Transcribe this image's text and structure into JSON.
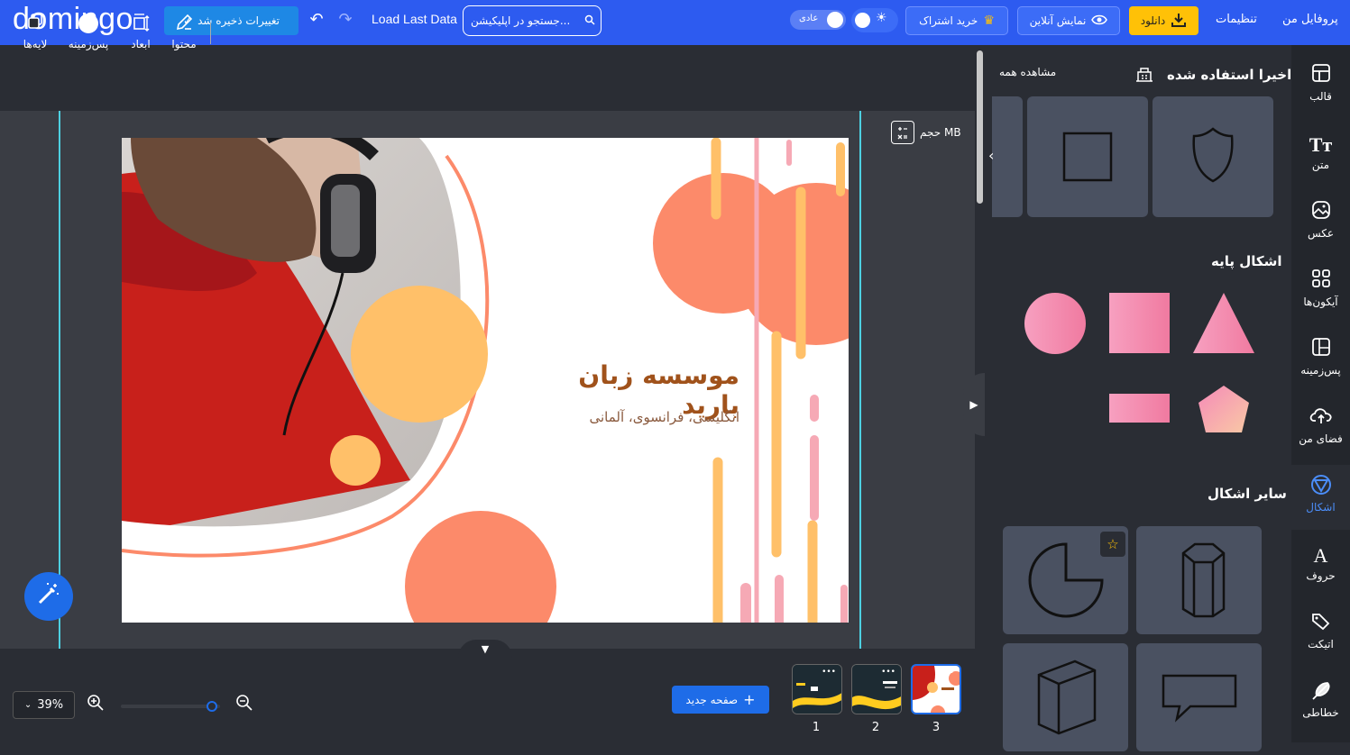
{
  "app": {
    "logo": "domingo"
  },
  "topbar": {
    "saved_label": "تغییرات ذخیره شد",
    "load_last": "Load Last Data",
    "search_placeholder": "جستجو در اپلیکیشن...",
    "mode_label": "عادی",
    "subscribe_label": "خرید اشتراک",
    "live_label": "نمایش آنلاین",
    "download_label": "دانلود",
    "settings_label": "تنظیمات",
    "profile_label": "پروفایل من"
  },
  "toolbar": {
    "items": [
      {
        "label": "لایه‌ها",
        "icon": "layers-icon"
      },
      {
        "label": "پس‌زمینه",
        "icon": "background-color-icon"
      },
      {
        "label": "ابعاد",
        "icon": "resize-icon"
      },
      {
        "label": "محتوا",
        "icon": "edit-icon"
      }
    ]
  },
  "workspace": {
    "size_label": "حجم MB",
    "slide_title": "موسسه زبان بارید",
    "slide_subtitle": "انگلیسی، فرانسوی، آلمانی"
  },
  "bottom": {
    "zoom": "39%",
    "new_page": "صفحه جدید",
    "pages": [
      "1",
      "2",
      "3"
    ],
    "active_page": "3"
  },
  "panel": {
    "recent_title": "اخیرا استفاده شده",
    "view_all": "مشاهده همه",
    "basic_title": "اشکال پایه",
    "other_title": "سایر اشکال"
  },
  "sidenav": {
    "items": [
      {
        "label": "قالب",
        "icon": "template-icon"
      },
      {
        "label": "متن",
        "icon": "text-icon"
      },
      {
        "label": "عکس",
        "icon": "photo-icon"
      },
      {
        "label": "آیکون‌ها",
        "icon": "icons-icon"
      },
      {
        "label": "پس‌زمینه",
        "icon": "background-icon"
      },
      {
        "label": "فضای من",
        "icon": "cloud-upload-icon"
      },
      {
        "label": "اشکال",
        "icon": "shapes-icon"
      },
      {
        "label": "حروف",
        "icon": "letters-icon"
      },
      {
        "label": "اتیکت",
        "icon": "tag-icon"
      },
      {
        "label": "خطاطی",
        "icon": "feather-icon"
      }
    ],
    "active": "اشکال"
  },
  "colors": {
    "topbar": "#2d5bf0",
    "accent": "#1e6ce8",
    "download": "#ffc107",
    "guide": "#4dd0e1",
    "slide_title": "#a0521b",
    "coral": "#fc8a6a",
    "peach": "#ffc069",
    "pink": "#f6a9b5"
  }
}
